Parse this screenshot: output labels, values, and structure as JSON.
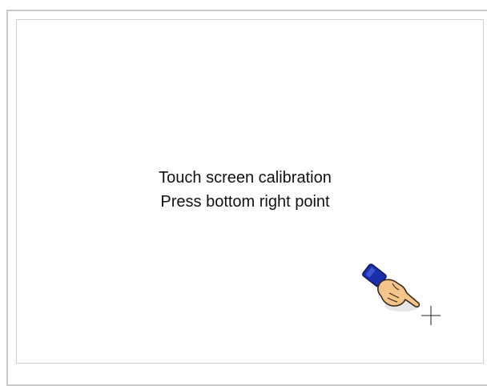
{
  "calibration": {
    "title": "Touch screen calibration",
    "instruction": "Press bottom right point",
    "pointer_icon": "pointing-hand-icon",
    "target_icon": "crosshair-icon",
    "colors": {
      "background": "#ffffff",
      "frame_border": "#c9c9c9",
      "text": "#111111",
      "cuff": "#1a2fa8",
      "skin": "#f4c48a"
    }
  }
}
